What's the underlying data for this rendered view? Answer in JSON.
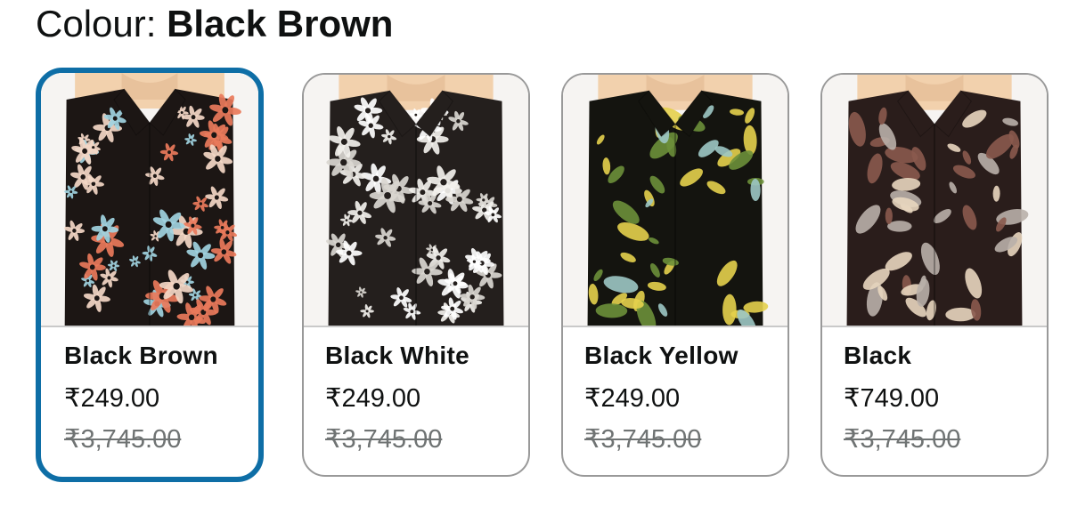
{
  "colour": {
    "label": "Colour: ",
    "selected": "Black Brown"
  },
  "swatches": [
    {
      "name": "Black Brown",
      "price": "₹249.00",
      "mrp": "₹3,745.00",
      "selected": true,
      "image_icon": "shirt-floral-black-brown",
      "colors": {
        "base": "#1c1614",
        "a": "#e9795b",
        "b": "#f3d7c6",
        "c": "#9fd3df"
      }
    },
    {
      "name": "Black White",
      "price": "₹249.00",
      "mrp": "₹3,745.00",
      "selected": false,
      "image_icon": "shirt-floral-black-white",
      "colors": {
        "base": "#241f1d",
        "a": "#f2f0ec",
        "b": "#d9d6d0",
        "c": "#ffffff"
      }
    },
    {
      "name": "Black Yellow",
      "price": "₹249.00",
      "mrp": "₹3,745.00",
      "selected": false,
      "image_icon": "shirt-tropical-black-yellow",
      "colors": {
        "base": "#14140f",
        "a": "#e4d04d",
        "b": "#6b8f3a",
        "c": "#9cc6c4"
      }
    },
    {
      "name": "Black",
      "price": "₹749.00",
      "mrp": "₹3,745.00",
      "selected": false,
      "image_icon": "shirt-tropical-black",
      "colors": {
        "base": "#2a1d1b",
        "a": "#8a5a4e",
        "b": "#e8d6bf",
        "c": "#b9b0aa"
      }
    }
  ],
  "accent": "#0e6ea6",
  "skin": "#f2d1ad"
}
